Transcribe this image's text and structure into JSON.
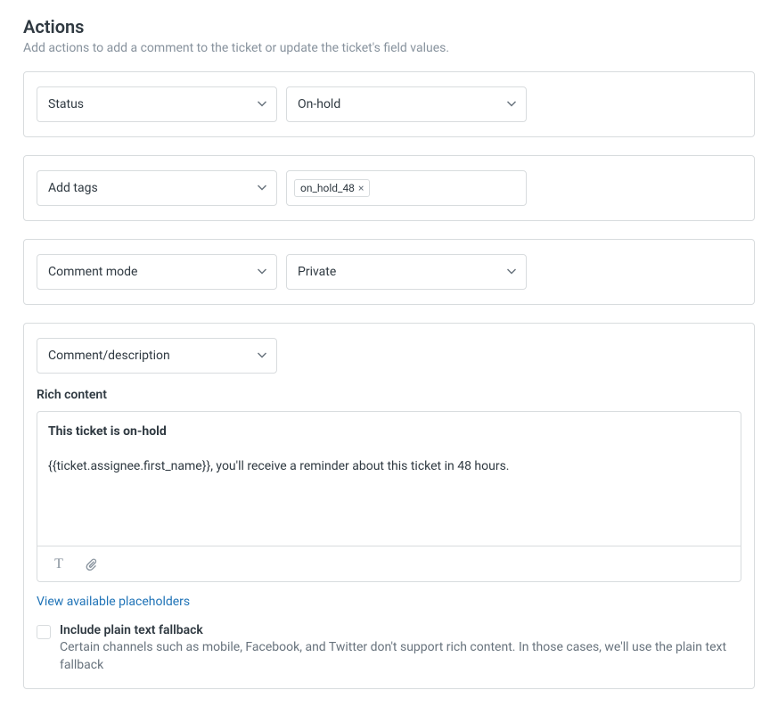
{
  "header": {
    "title": "Actions",
    "description": "Add actions to add a comment to the ticket or update the ticket's field values."
  },
  "actions": {
    "status": {
      "field_label": "Status",
      "value_label": "On-hold"
    },
    "tags": {
      "field_label": "Add tags",
      "chips": [
        "on_hold_48"
      ]
    },
    "comment_mode": {
      "field_label": "Comment mode",
      "value_label": "Private"
    },
    "comment": {
      "field_label": "Comment/description",
      "rich_label": "Rich content",
      "body_bold": "This ticket is on-hold",
      "body_text": "{{ticket.assignee.first_name}}, you'll receive a reminder about this ticket in 48 hours.",
      "placeholders_link": "View available placeholders",
      "fallback_label": "Include plain text fallback",
      "fallback_help": "Certain channels such as mobile, Facebook, and Twitter don't support rich content. In those cases, we'll use the plain text fallback"
    }
  }
}
